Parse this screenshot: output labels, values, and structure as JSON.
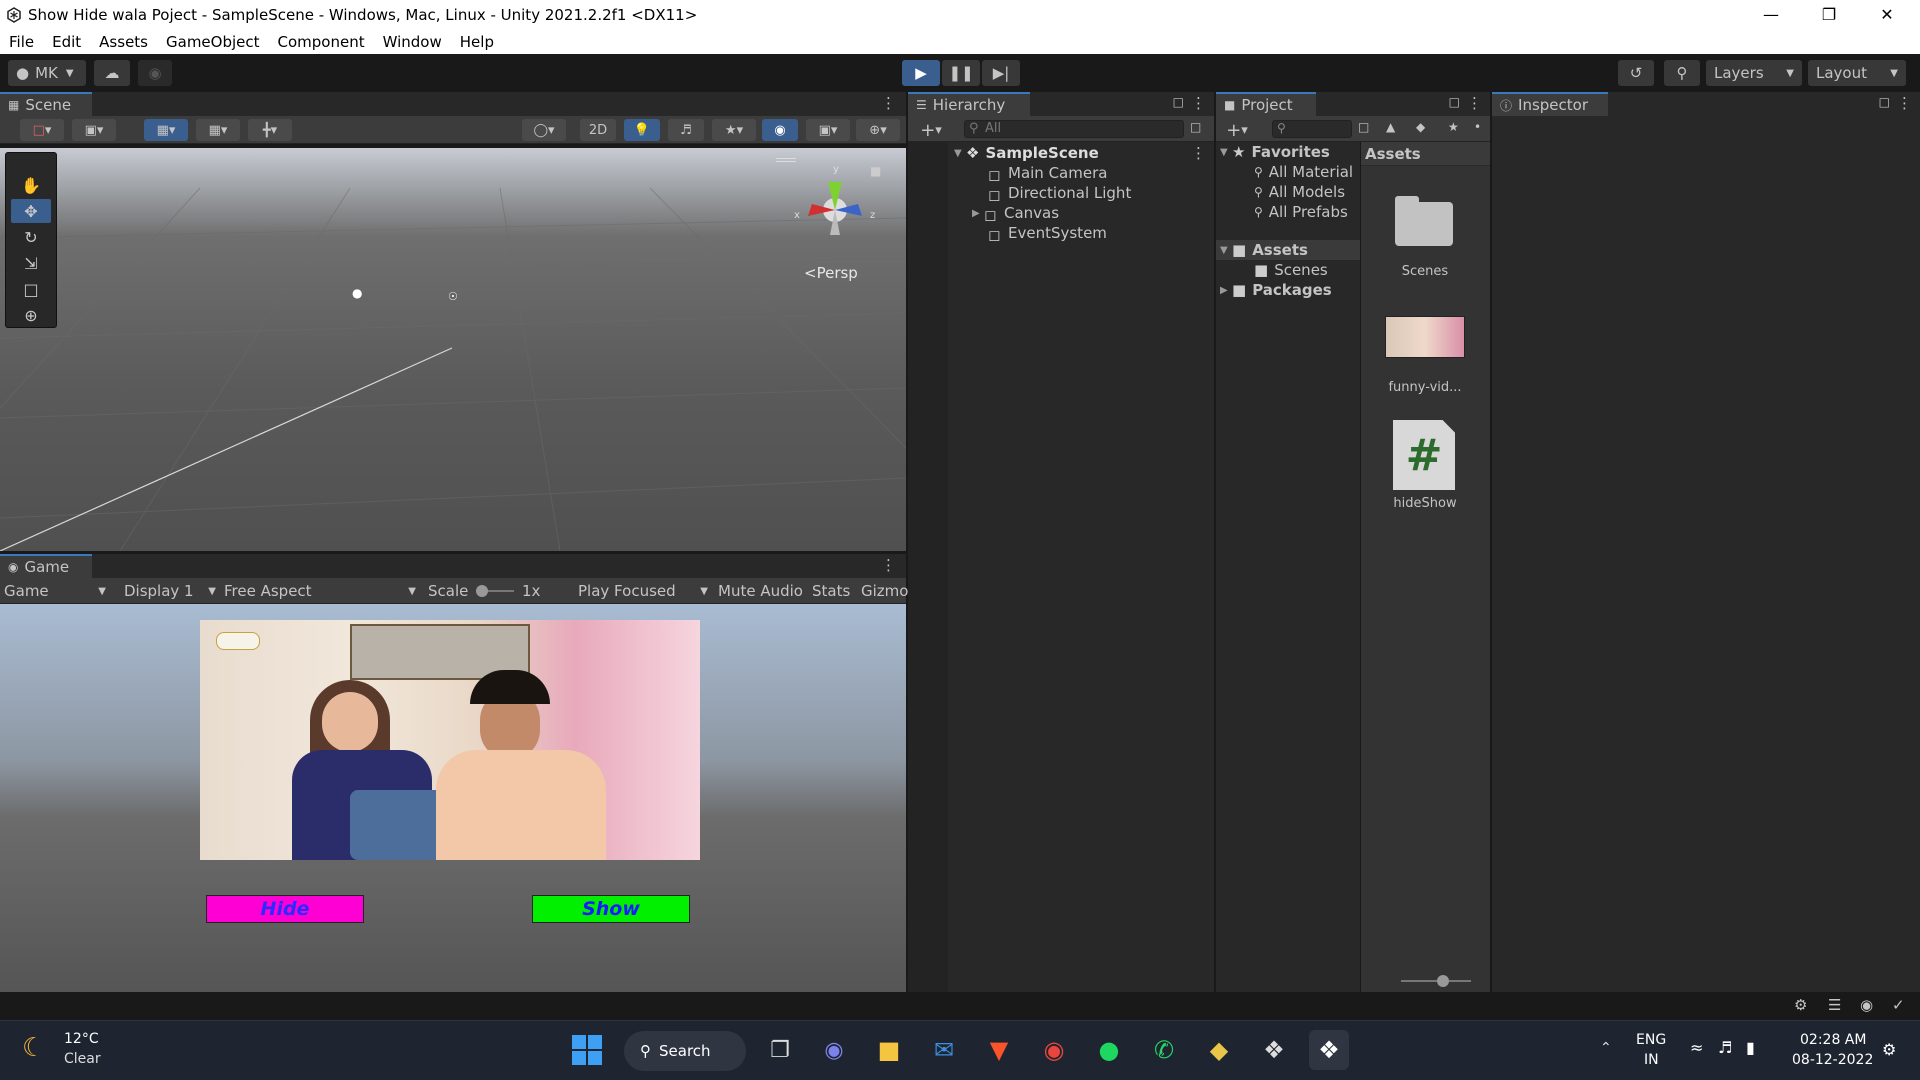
{
  "window": {
    "title": "Show Hide wala Poject - SampleScene - Windows, Mac, Linux - Unity 2021.2.2f1 <DX11>"
  },
  "menu": [
    "File",
    "Edit",
    "Assets",
    "GameObject",
    "Component",
    "Window",
    "Help"
  ],
  "toolbar": {
    "account": "MK",
    "layers": "Layers",
    "layout": "Layout"
  },
  "scene": {
    "tab": "Scene",
    "mode_2d": "2D",
    "persp": "Persp",
    "gizmo_axes": {
      "x": "x",
      "y": "y",
      "z": "z"
    }
  },
  "game": {
    "tab": "Game",
    "dropdown_game": "Game",
    "display": "Display 1",
    "aspect": "Free Aspect",
    "scale_label": "Scale",
    "scale_value": "1x",
    "play_focused": "Play Focused",
    "mute": "Mute Audio",
    "stats": "Stats",
    "gizmos": "Gizmo",
    "hide_label": "Hide",
    "show_label": "Show"
  },
  "hierarchy": {
    "tab": "Hierarchy",
    "search_placeholder": "All",
    "scene_name": "SampleScene",
    "items": [
      "Main Camera",
      "Directional Light",
      "Canvas",
      "EventSystem"
    ]
  },
  "project": {
    "tab": "Project",
    "favorites": "Favorites",
    "favorites_items": [
      "All Material",
      "All Models",
      "All Prefabs"
    ],
    "assets_root": "Assets",
    "assets_children": [
      "Scenes"
    ],
    "packages": "Packages",
    "assets_header": "Assets",
    "asset_items": [
      "Scenes",
      "funny-vid...",
      "hideShow"
    ],
    "script_glyph": "#"
  },
  "inspector": {
    "tab": "Inspector"
  },
  "taskbar": {
    "weather_temp": "12°C",
    "weather_desc": "Clear",
    "search": "Search",
    "lang1": "ENG",
    "lang2": "IN",
    "time": "02:28 AM",
    "date": "08-12-2022"
  },
  "colors": {
    "hide_bg": "#ff00d4",
    "hide_text": "#2b2bff",
    "show_bg": "#00f000",
    "show_text": "#1a1aff",
    "accent": "#3a79bb"
  }
}
